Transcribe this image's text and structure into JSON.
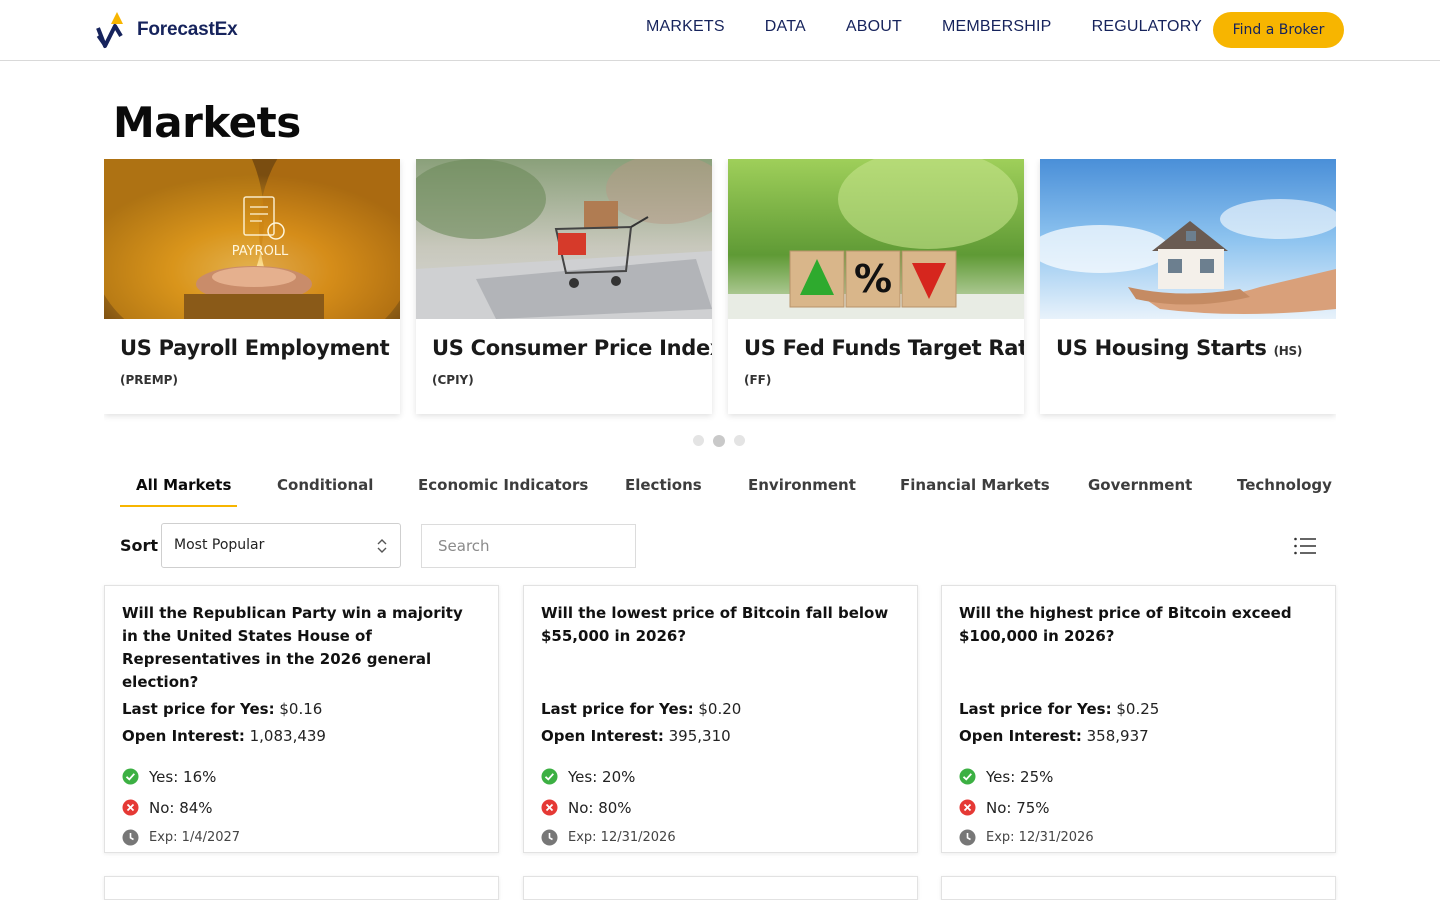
{
  "header": {
    "logo_text": "ForecastEx",
    "nav": [
      "MARKETS",
      "DATA",
      "ABOUT",
      "MEMBERSHIP",
      "REGULATORY"
    ],
    "cta_label": "Find a Broker"
  },
  "page": {
    "title": "Markets"
  },
  "featured": [
    {
      "name": "US Payroll Employment",
      "code": "(PREMP)",
      "image": "payroll-photo"
    },
    {
      "name": "US Consumer Price Index",
      "code": "(CPIY)",
      "image": "shopping-cart-photo"
    },
    {
      "name": "US Fed Funds Target Rate",
      "code": "(FF)",
      "image": "rate-blocks-photo"
    },
    {
      "name": "US Housing Starts",
      "code": "(HS)",
      "image": "house-in-hand-photo"
    }
  ],
  "carousel": {
    "dot_count": 3,
    "active_dot": 1
  },
  "tabs": [
    "All Markets",
    "Conditional",
    "Economic Indicators",
    "Elections",
    "Environment",
    "Financial Markets",
    "Government",
    "Technology"
  ],
  "filters": {
    "sort_label": "Sort",
    "sort_value": "Most Popular",
    "search_placeholder": "Search"
  },
  "labels": {
    "last_price": "Last price for Yes:",
    "open_interest": "Open Interest:"
  },
  "markets": [
    {
      "question": "Will the Republican Party win a majority in the United States House of Representatives in the 2026 general election?",
      "last_price": "$0.16",
      "open_interest": "1,083,439",
      "yes": "Yes: 16%",
      "no": "No: 84%",
      "exp": "Exp: 1/4/2027"
    },
    {
      "question": "Will the lowest price of Bitcoin fall below $55,000 in 2026?",
      "last_price": "$0.20",
      "open_interest": "395,310",
      "yes": "Yes: 20%",
      "no": "No: 80%",
      "exp": "Exp: 12/31/2026"
    },
    {
      "question": "Will the highest price of Bitcoin exceed $100,000 in 2026?",
      "last_price": "$0.25",
      "open_interest": "358,937",
      "yes": "Yes: 25%",
      "no": "No: 75%",
      "exp": "Exp: 12/31/2026"
    }
  ],
  "colors": {
    "brand_navy": "#16235c",
    "accent_yellow": "#f7b500",
    "yes_green": "#3cb043",
    "no_red": "#e53935"
  }
}
